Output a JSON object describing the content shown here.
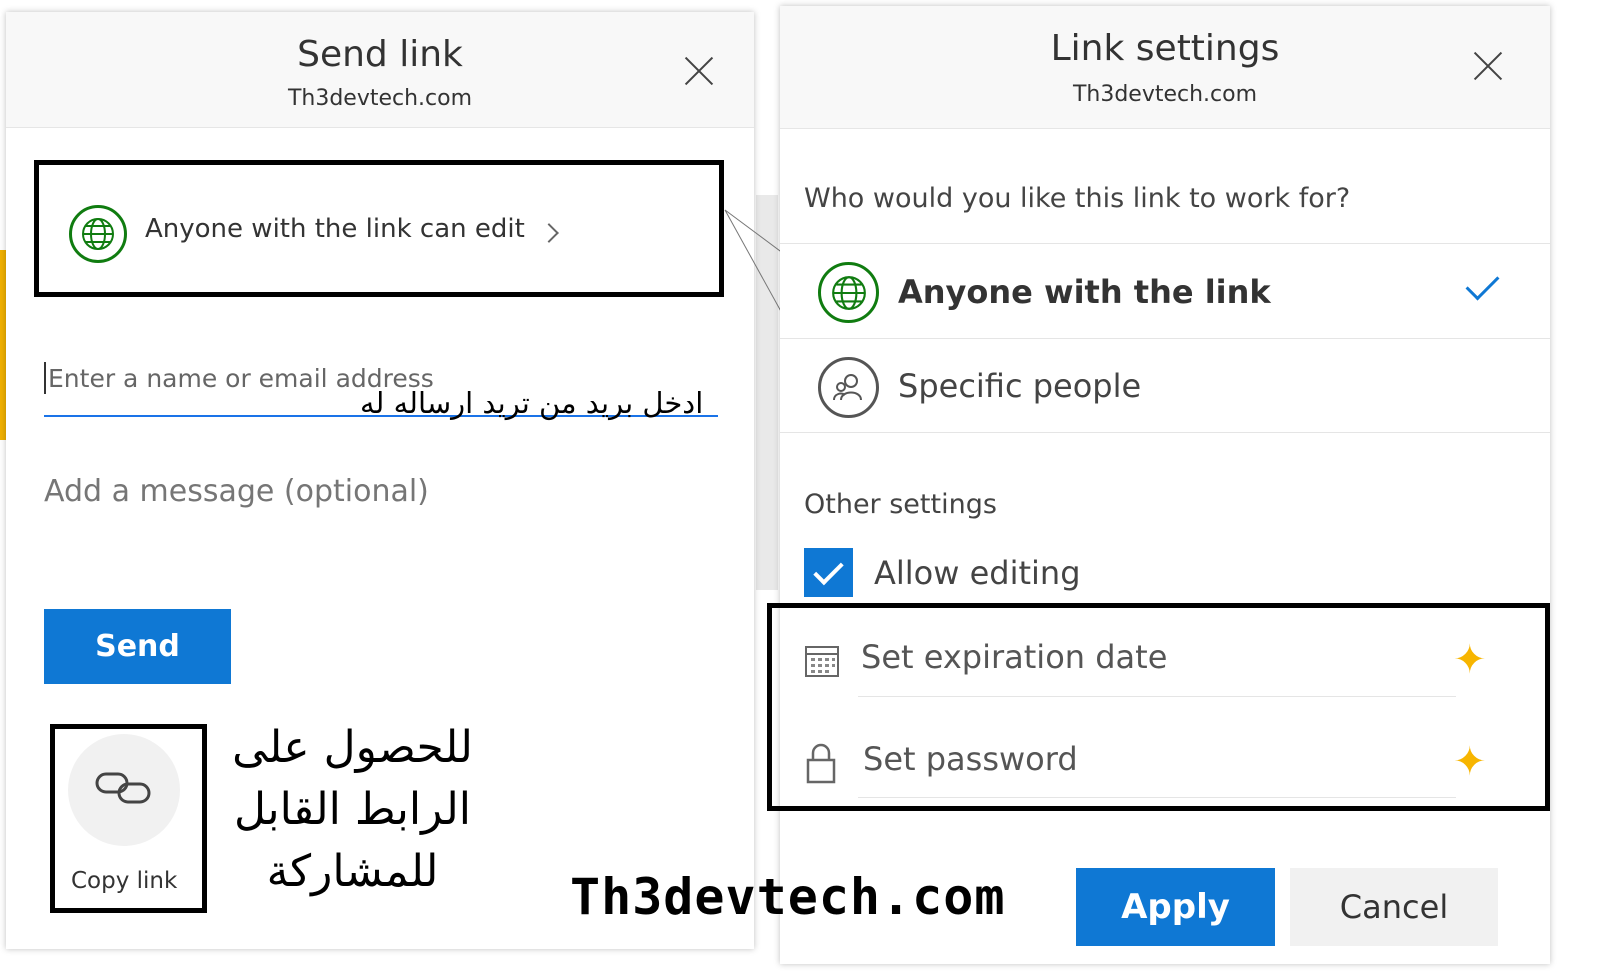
{
  "send_dialog": {
    "title": "Send link",
    "subtitle": "Th3devtech.com",
    "permission_label": "Anyone with the link can edit",
    "email_placeholder": "Enter a name or email address",
    "email_annotation": "ادخل بريد من تريد ارساله له",
    "message_placeholder": "Add a message (optional)",
    "send_label": "Send",
    "copy_link_label": "Copy link",
    "copy_annotation_lines": [
      "للحصول على",
      "الرابط القابل",
      "للمشاركة"
    ]
  },
  "settings_dialog": {
    "title": "Link settings",
    "subtitle": "Th3devtech.com",
    "question": "Who would you like this link to work for?",
    "options": [
      {
        "label": "Anyone with the link",
        "selected": true
      },
      {
        "label": "Specific people",
        "selected": false
      }
    ],
    "other_settings_label": "Other settings",
    "allow_editing_label": "Allow editing",
    "allow_editing_checked": true,
    "expiration_label": "Set expiration date",
    "password_label": "Set password",
    "apply_label": "Apply",
    "cancel_label": "Cancel"
  },
  "watermark": "Th3devtech.com",
  "colors": {
    "accent": "#0f78d4",
    "globe": "#107c10",
    "premium_star": "#f7b500"
  }
}
